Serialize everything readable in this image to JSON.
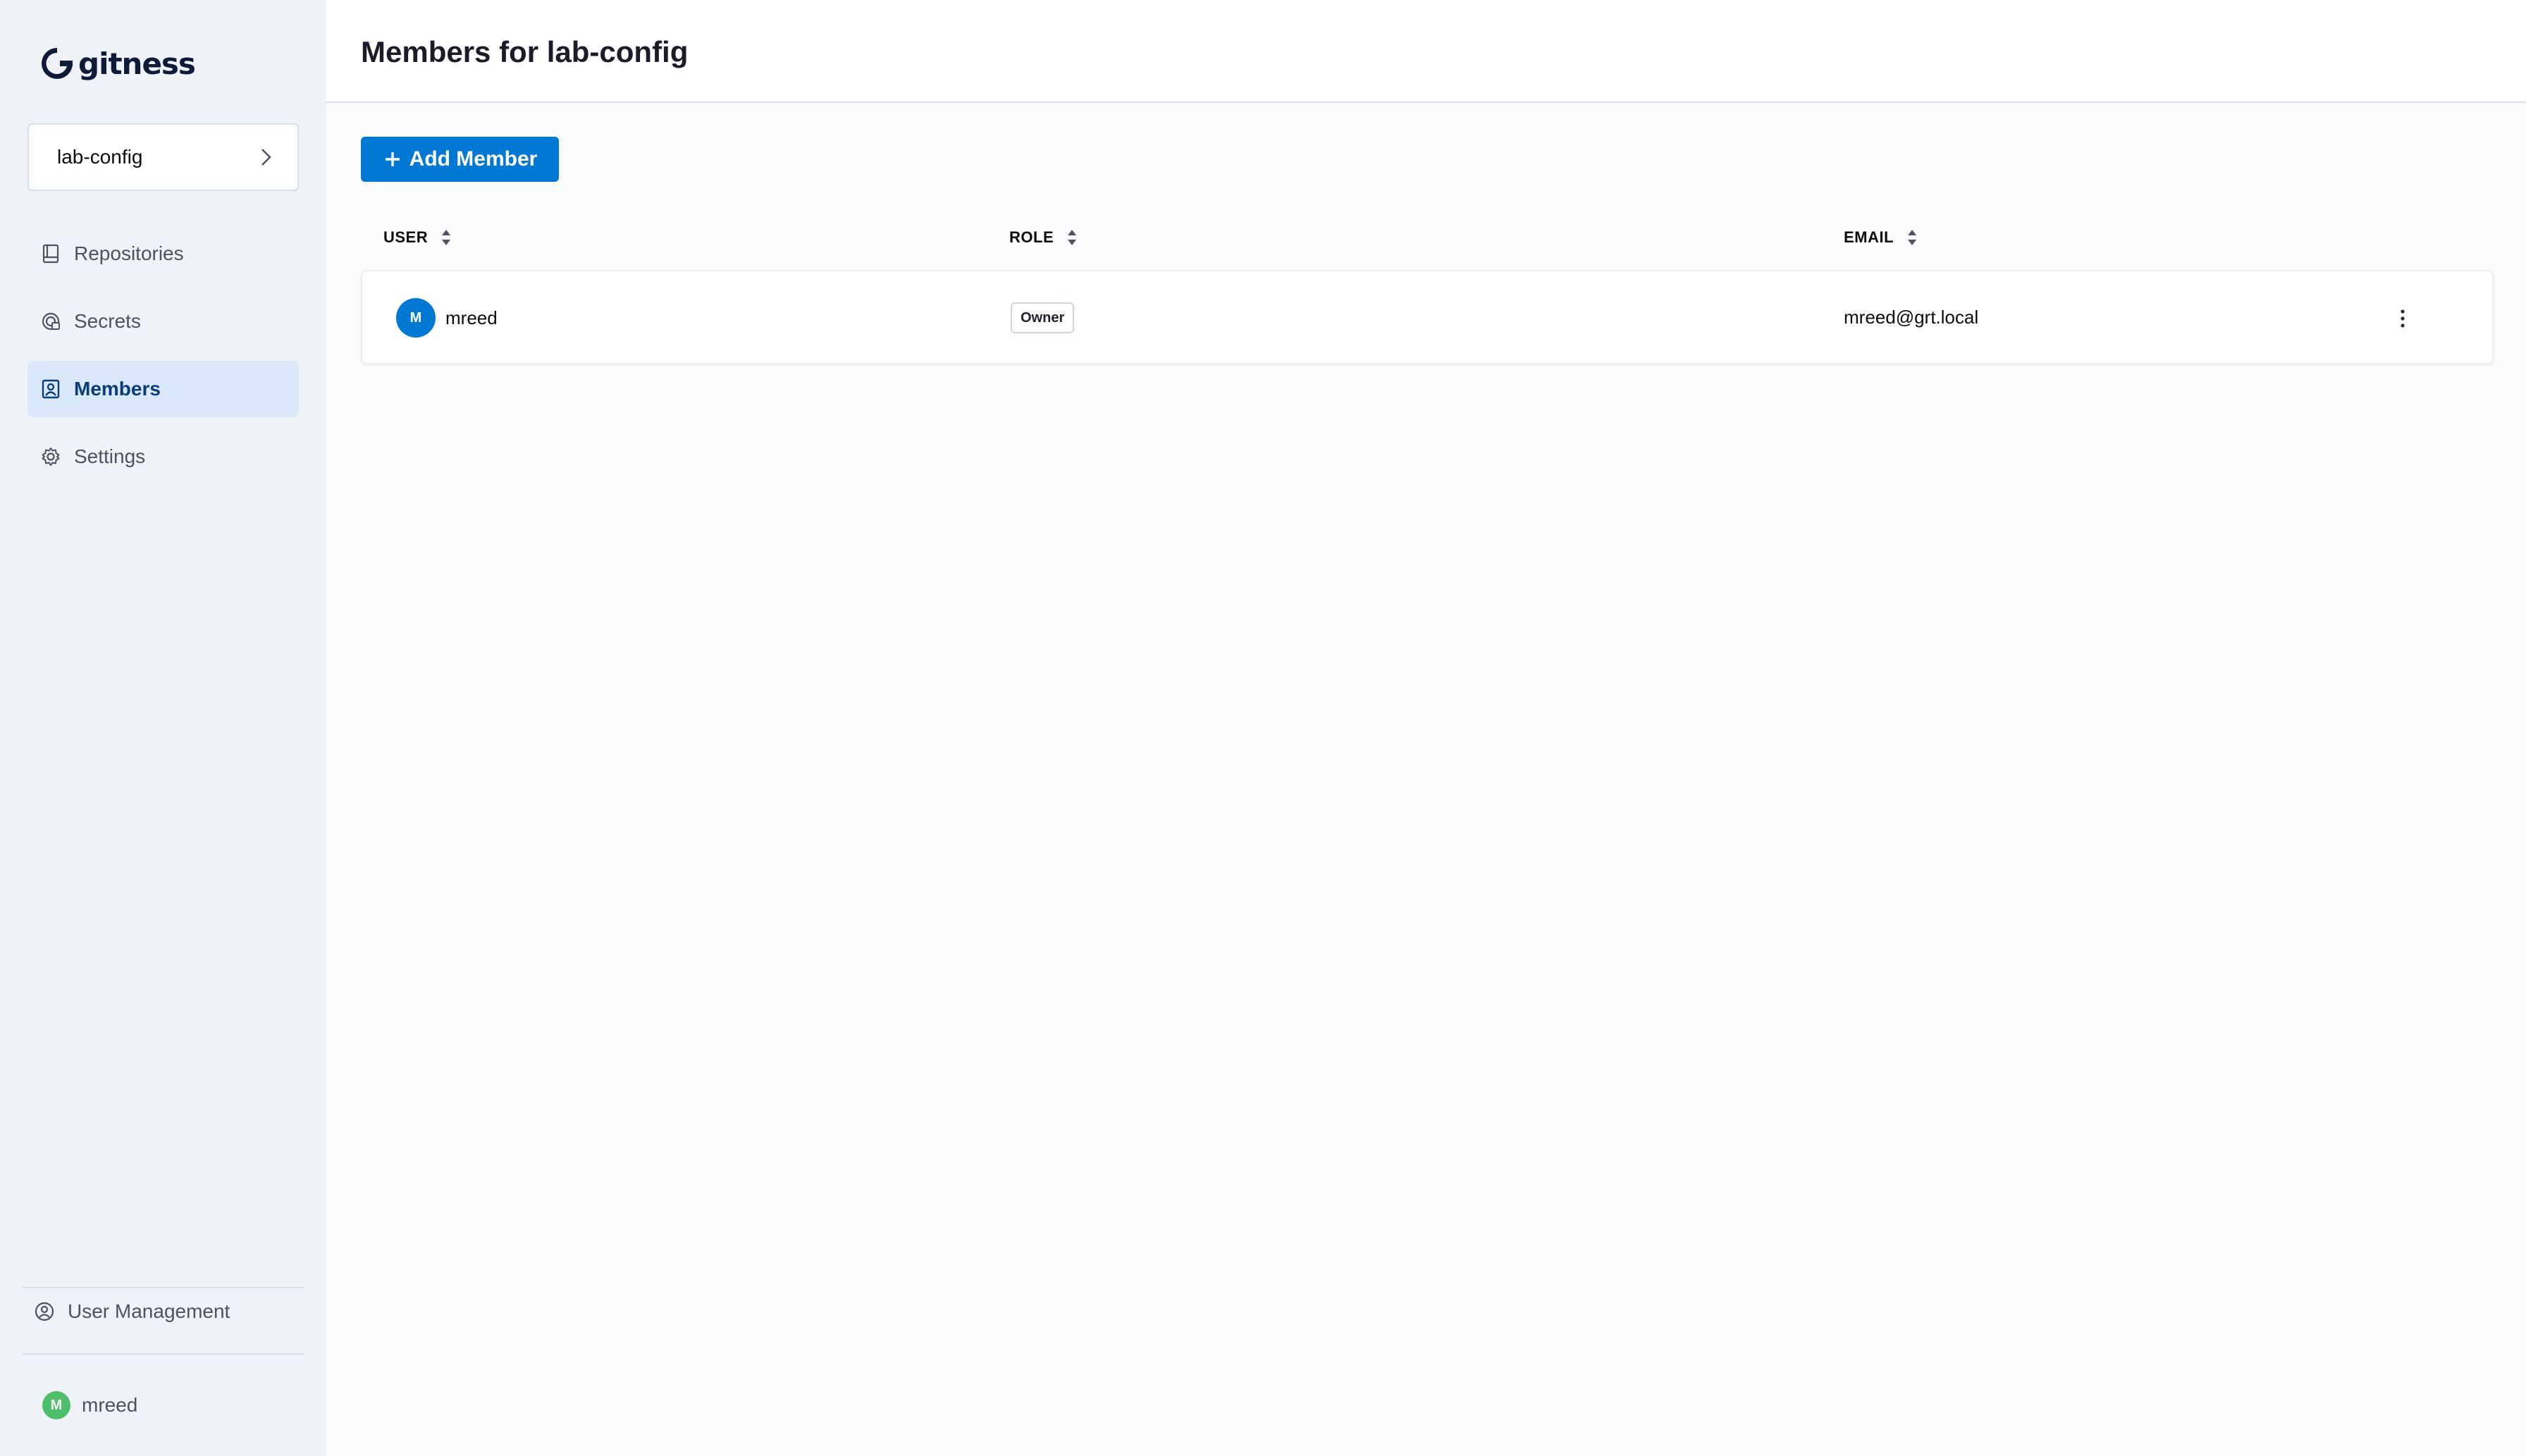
{
  "app": {
    "logo_text": "gitness"
  },
  "sidebar": {
    "space_name": "lab-config",
    "items": [
      {
        "label": "Repositories",
        "icon": "repository-icon",
        "active": false
      },
      {
        "label": "Secrets",
        "icon": "secrets-icon",
        "active": false
      },
      {
        "label": "Members",
        "icon": "members-icon",
        "active": true
      },
      {
        "label": "Settings",
        "icon": "gear-icon",
        "active": false
      }
    ],
    "user_management_label": "User Management",
    "profile": {
      "initial": "M",
      "name": "mreed"
    }
  },
  "header": {
    "title": "Members for lab-config"
  },
  "toolbar": {
    "add_member_label": "Add Member"
  },
  "table": {
    "columns": [
      "USER",
      "ROLE",
      "EMAIL"
    ],
    "rows": [
      {
        "initial": "M",
        "user": "mreed",
        "role": "Owner",
        "email": "mreed@grt.local"
      }
    ]
  },
  "colors": {
    "accent": "#0278d5",
    "sidebar_bg": "#eff2f7",
    "active_nav_bg": "#d9e9fb",
    "profile_avatar": "#4dbf6a"
  }
}
